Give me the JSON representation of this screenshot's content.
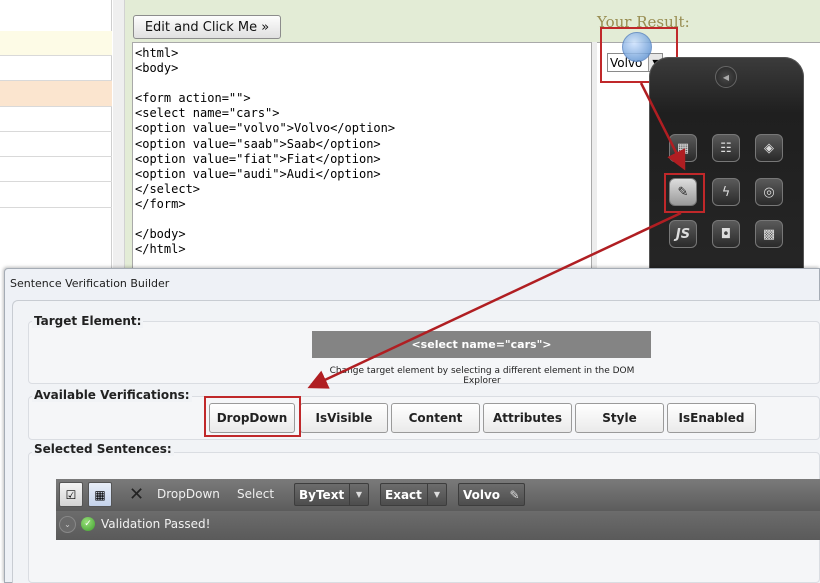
{
  "editor": {
    "button_label": "Edit and Click Me »",
    "code_lines": [
      "<html>",
      "<body>",
      "",
      "<form action=\"\">",
      "<select name=\"cars\">",
      "<option value=\"volvo\">Volvo</option>",
      "<option value=\"saab\">Saab</option>",
      "<option value=\"fiat\">Fiat</option>",
      "<option value=\"audi\">Audi</option>",
      "</select>",
      "</form>",
      "",
      "</body>",
      "</html>"
    ],
    "result_label": "Your Result:",
    "result_select_value": "Volvo"
  },
  "toolbar_icons": [
    "grid-check-icon",
    "tree-icon",
    "cube-3d-icon",
    "document-edit-icon",
    "lightning-icon",
    "globe-search-icon",
    "javascript-icon",
    "mouse-icon",
    "grid-select-icon"
  ],
  "dialog": {
    "title": "Sentence Verification Builder",
    "target_label": "Target Element:",
    "target_value": "<select name=\"cars\">",
    "target_hint": "Change target element by selecting a different element in the DOM Explorer",
    "available_label": "Available Verifications:",
    "verifications": [
      "DropDown",
      "IsVisible",
      "Content",
      "Attributes",
      "Style",
      "IsEnabled"
    ],
    "selected_label": "Selected Sentences:",
    "sentence": {
      "element": "DropDown",
      "action": "Select",
      "by": "ByText",
      "mode": "Exact",
      "value": "Volvo"
    },
    "validation": "Validation Passed!"
  },
  "colors": {
    "highlight": "#c0282a",
    "tryit_bg": "#e3ecd6",
    "sentence_bar": "#666666"
  }
}
